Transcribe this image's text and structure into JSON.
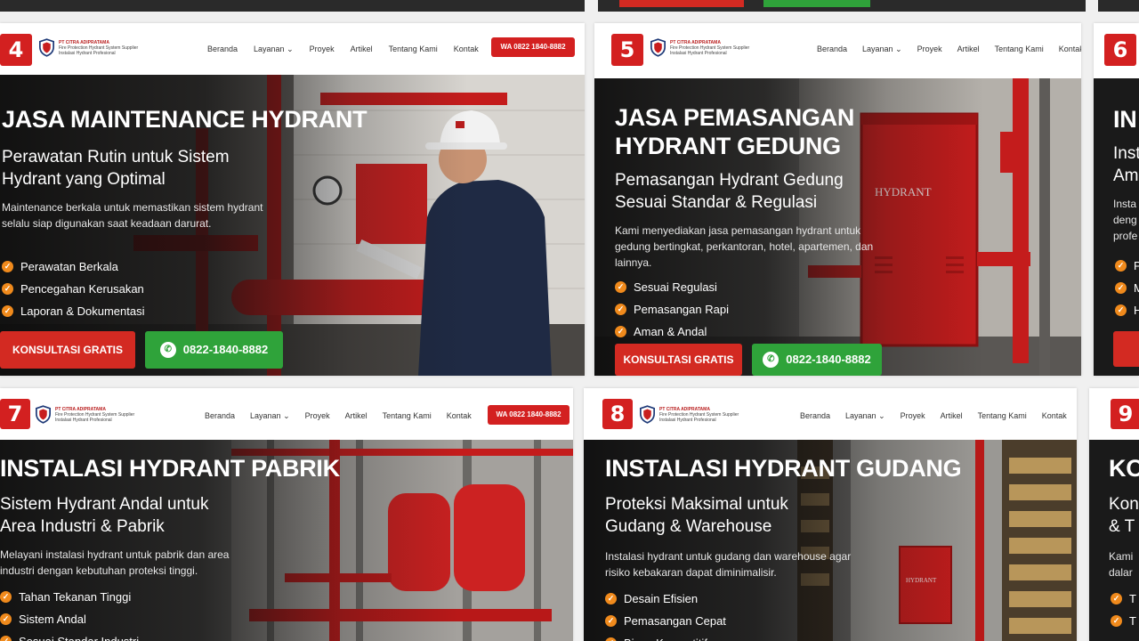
{
  "nav": {
    "menu": [
      "Beranda",
      "Layanan",
      "Proyek",
      "Artikel",
      "Tentang Kami",
      "Kontak"
    ],
    "phone_badge": "WA 0822 1840-8882",
    "logo_lines": [
      "PT CITRA ADIPRATAMA",
      "Fire Protection Hydrant System Supplier",
      "Instalasi Hydrant Profesional"
    ]
  },
  "cards": [
    {
      "number": "4",
      "title": "JASA MAINTENANCE HYDRANT",
      "subtitle_lines": [
        "Perawatan Rutin untuk Sistem",
        "Hydrant yang Optimal"
      ],
      "description": "Maintenance berkala untuk memastikan sistem hydrant selalu siap digunakan saat keadaan darurat.",
      "bullets": [
        "Perawatan Berkala",
        "Pencegahan Kerusakan",
        "Laporan & Dokumentasi"
      ],
      "cta": "KONSULTASI GRATIS",
      "whatsapp": "0822-1840-8882"
    },
    {
      "number": "5",
      "title_lines": [
        "JASA PEMASANGAN",
        "HYDRANT GEDUNG"
      ],
      "subtitle_lines": [
        "Pemasangan Hydrant Gedung",
        "Sesuai Standar & Regulasi"
      ],
      "description": "Kami menyediakan jasa pemasangan hydrant untuk gedung bertingkat, perkantoran, hotel, apartemen, dan lainnya.",
      "bullets": [
        "Sesuai Regulasi",
        "Pemasangan Rapi",
        "Aman & Andal"
      ],
      "cta": "KONSULTASI GRATIS",
      "whatsapp": "0822-1840-8882",
      "cabinet_label": "HYDRANT"
    },
    {
      "number": "6",
      "title": "IN",
      "subtitle_lines": [
        "Inst",
        "Am"
      ],
      "description_lines": [
        "Insta",
        "deng",
        "profe"
      ],
      "bullets": [
        "P",
        "M",
        "H"
      ]
    },
    {
      "number": "7",
      "title": "INSTALASI HYDRANT PABRIK",
      "subtitle_lines": [
        "Sistem Hydrant Andal untuk",
        "Area Industri & Pabrik"
      ],
      "description": "Melayani instalasi hydrant untuk pabrik dan area industri dengan kebutuhan proteksi tinggi.",
      "bullets": [
        "Tahan Tekanan Tinggi",
        "Sistem Andal",
        "Sesuai Standar Industri"
      ]
    },
    {
      "number": "8",
      "title": "INSTALASI HYDRANT GUDANG",
      "subtitle_lines": [
        "Proteksi Maksimal untuk",
        "Gudang & Warehouse"
      ],
      "description": "Instalasi hydrant untuk gudang dan warehouse agar risiko kebakaran dapat diminimalisir.",
      "bullets": [
        "Desain Efisien",
        "Pemasangan Cepat",
        "Biaya Kompetitif"
      ],
      "cabinet_label": "HYDRANT"
    },
    {
      "number": "9",
      "title": "KO",
      "subtitle_lines": [
        "Kon",
        "& T"
      ],
      "description_lines": [
        "Kami",
        "dalar"
      ],
      "bullets": [
        "T",
        "T"
      ]
    }
  ],
  "colors": {
    "brand_red": "#d32020",
    "whatsapp_green": "#2fa33a",
    "check_orange": "#f08a1c"
  }
}
